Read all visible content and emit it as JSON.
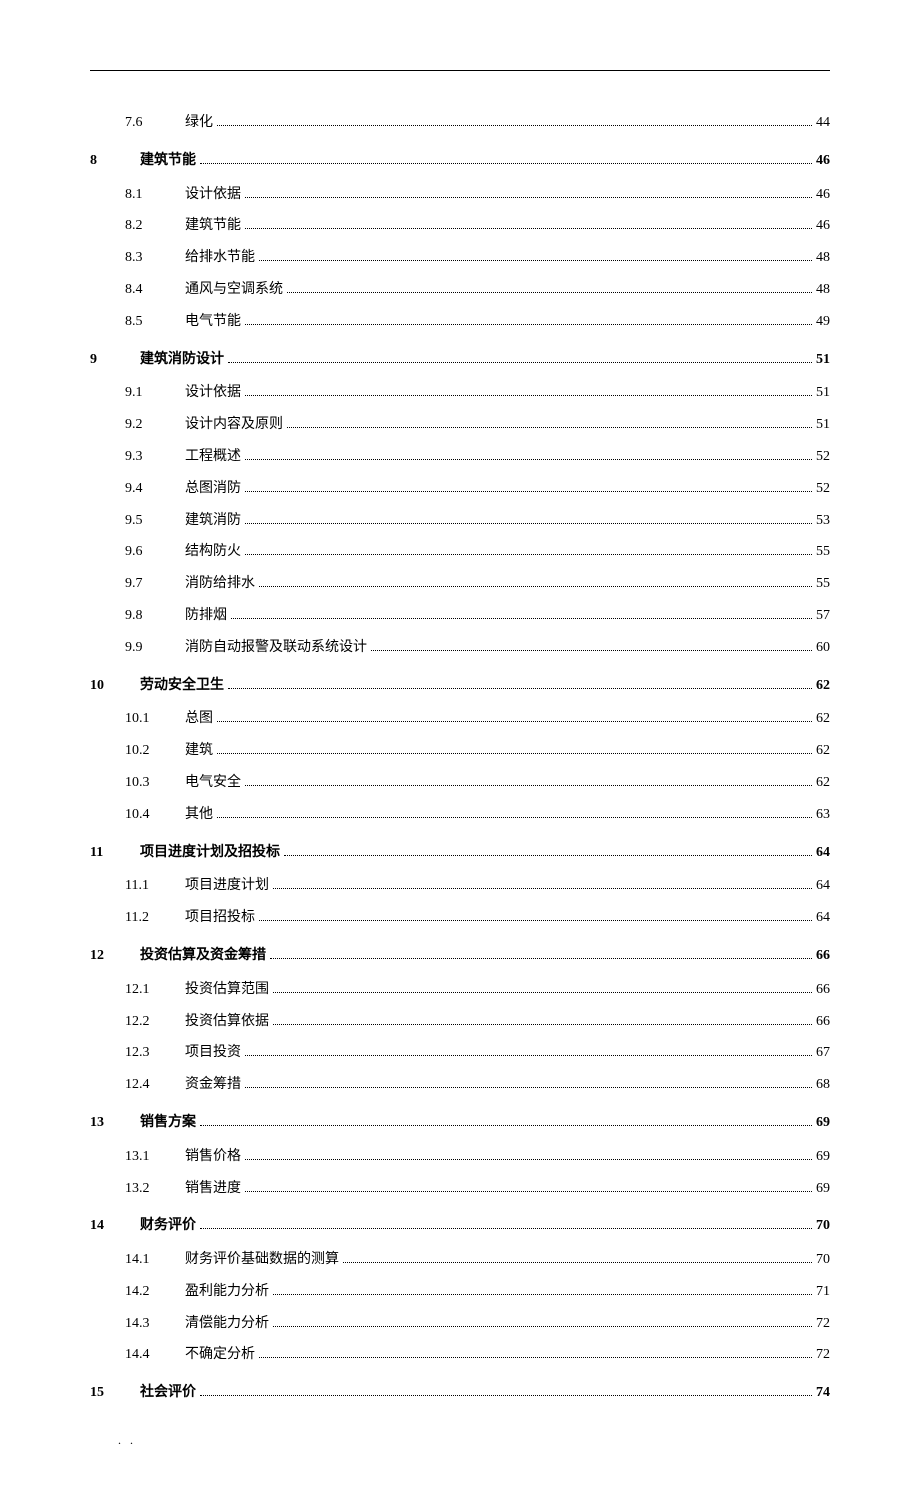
{
  "toc": [
    {
      "level": "section",
      "num": "7.6",
      "title": "绿化",
      "page": "44"
    },
    {
      "level": "chapter",
      "num": "8",
      "title": "建筑节能",
      "page": "46"
    },
    {
      "level": "section",
      "num": "8.1",
      "title": "设计依据",
      "page": "46"
    },
    {
      "level": "section",
      "num": "8.2",
      "title": "建筑节能",
      "page": "46"
    },
    {
      "level": "section",
      "num": "8.3",
      "title": "给排水节能",
      "page": "48"
    },
    {
      "level": "section",
      "num": "8.4",
      "title": "通风与空调系统",
      "page": "48"
    },
    {
      "level": "section",
      "num": "8.5",
      "title": "电气节能",
      "page": "49"
    },
    {
      "level": "chapter",
      "num": "9",
      "title": "建筑消防设计",
      "page": "51"
    },
    {
      "level": "section",
      "num": "9.1",
      "title": "设计依据",
      "page": "51"
    },
    {
      "level": "section",
      "num": "9.2",
      "title": "设计内容及原则",
      "page": "51"
    },
    {
      "level": "section",
      "num": "9.3",
      "title": "工程概述",
      "page": "52"
    },
    {
      "level": "section",
      "num": "9.4",
      "title": "总图消防",
      "page": "52"
    },
    {
      "level": "section",
      "num": "9.5",
      "title": "建筑消防",
      "page": "53"
    },
    {
      "level": "section",
      "num": "9.6",
      "title": "结构防火",
      "page": "55"
    },
    {
      "level": "section",
      "num": "9.7",
      "title": "消防给排水",
      "page": "55"
    },
    {
      "level": "section",
      "num": "9.8",
      "title": "防排烟",
      "page": "57"
    },
    {
      "level": "section",
      "num": "9.9",
      "title": "消防自动报警及联动系统设计",
      "page": "60"
    },
    {
      "level": "chapter",
      "num": "10",
      "title": "劳动安全卫生",
      "page": "62"
    },
    {
      "level": "section",
      "num": "10.1",
      "title": "总图",
      "page": "62"
    },
    {
      "level": "section",
      "num": "10.2",
      "title": "建筑",
      "page": "62"
    },
    {
      "level": "section",
      "num": "10.3",
      "title": "电气安全",
      "page": "62"
    },
    {
      "level": "section",
      "num": "10.4",
      "title": "其他",
      "page": "63"
    },
    {
      "level": "chapter",
      "num": "11",
      "title": "项目进度计划及招投标",
      "page": "64"
    },
    {
      "level": "section",
      "num": "11.1",
      "title": "项目进度计划",
      "page": "64"
    },
    {
      "level": "section",
      "num": "11.2",
      "title": "项目招投标",
      "page": "64"
    },
    {
      "level": "chapter",
      "num": "12",
      "title": "投资估算及资金筹措",
      "page": "66"
    },
    {
      "level": "section",
      "num": "12.1",
      "title": "投资估算范围",
      "page": "66"
    },
    {
      "level": "section",
      "num": "12.2",
      "title": "投资估算依据",
      "page": "66"
    },
    {
      "level": "section",
      "num": "12.3",
      "title": "项目投资",
      "page": "67"
    },
    {
      "level": "section",
      "num": "12.4",
      "title": "资金筹措",
      "page": "68"
    },
    {
      "level": "chapter",
      "num": "13",
      "title": "销售方案",
      "page": "69"
    },
    {
      "level": "section",
      "num": "13.1",
      "title": "销售价格",
      "page": "69"
    },
    {
      "level": "section",
      "num": "13.2",
      "title": "销售进度",
      "page": "69"
    },
    {
      "level": "chapter",
      "num": "14",
      "title": "财务评价",
      "page": "70"
    },
    {
      "level": "section",
      "num": "14.1",
      "title": "财务评价基础数据的测算",
      "page": "70"
    },
    {
      "level": "section",
      "num": "14.2",
      "title": "盈利能力分析",
      "page": "71"
    },
    {
      "level": "section",
      "num": "14.3",
      "title": "清偿能力分析",
      "page": "72"
    },
    {
      "level": "section",
      "num": "14.4",
      "title": "不确定分析",
      "page": "72"
    },
    {
      "level": "chapter",
      "num": "15",
      "title": "社会评价",
      "page": "74"
    }
  ],
  "footer": ". ."
}
